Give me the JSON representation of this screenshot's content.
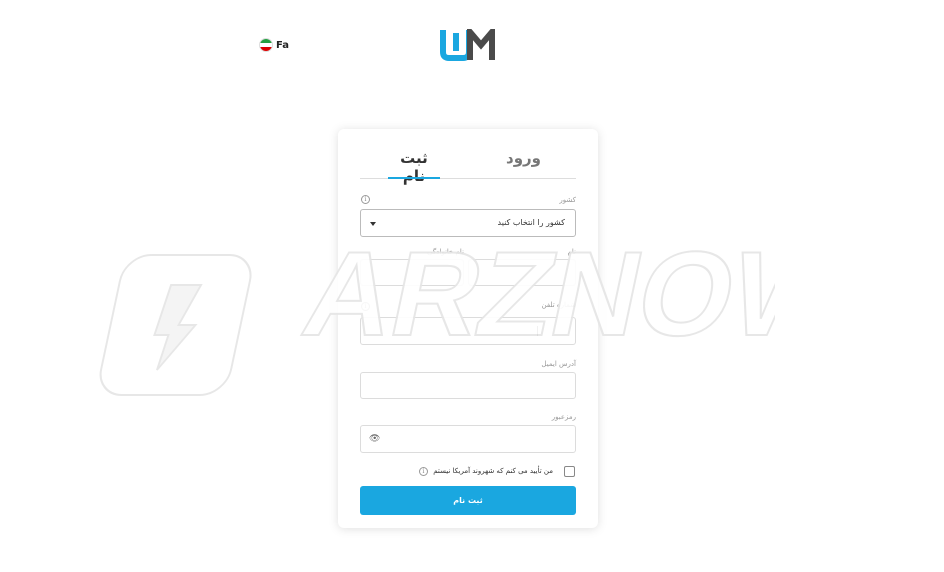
{
  "header": {
    "language": {
      "code": "Fa",
      "flag_icon": "iran-flag-icon"
    }
  },
  "logo": {
    "text": "WM"
  },
  "tabs": {
    "register": "ثبت نام",
    "login": "ورود",
    "active": "register"
  },
  "form": {
    "country_label": "کشور",
    "country_value": "کشور را انتخاب کنید",
    "first_name_label": "نام",
    "last_name_label": "نام خانوادگی",
    "phone_label": "شماره تلفن",
    "email_label": "آدرس ایمیل",
    "password_label": "رمزعبور",
    "us_citizen_confirm": "من تأیید می کنم که شهروند آمریکا نیستم",
    "submit_label": "ثبت نام"
  },
  "watermark": {
    "text": "ARZNOW"
  },
  "colors": {
    "accent": "#1aa7e0",
    "logo_dark": "#4a4a4a"
  }
}
